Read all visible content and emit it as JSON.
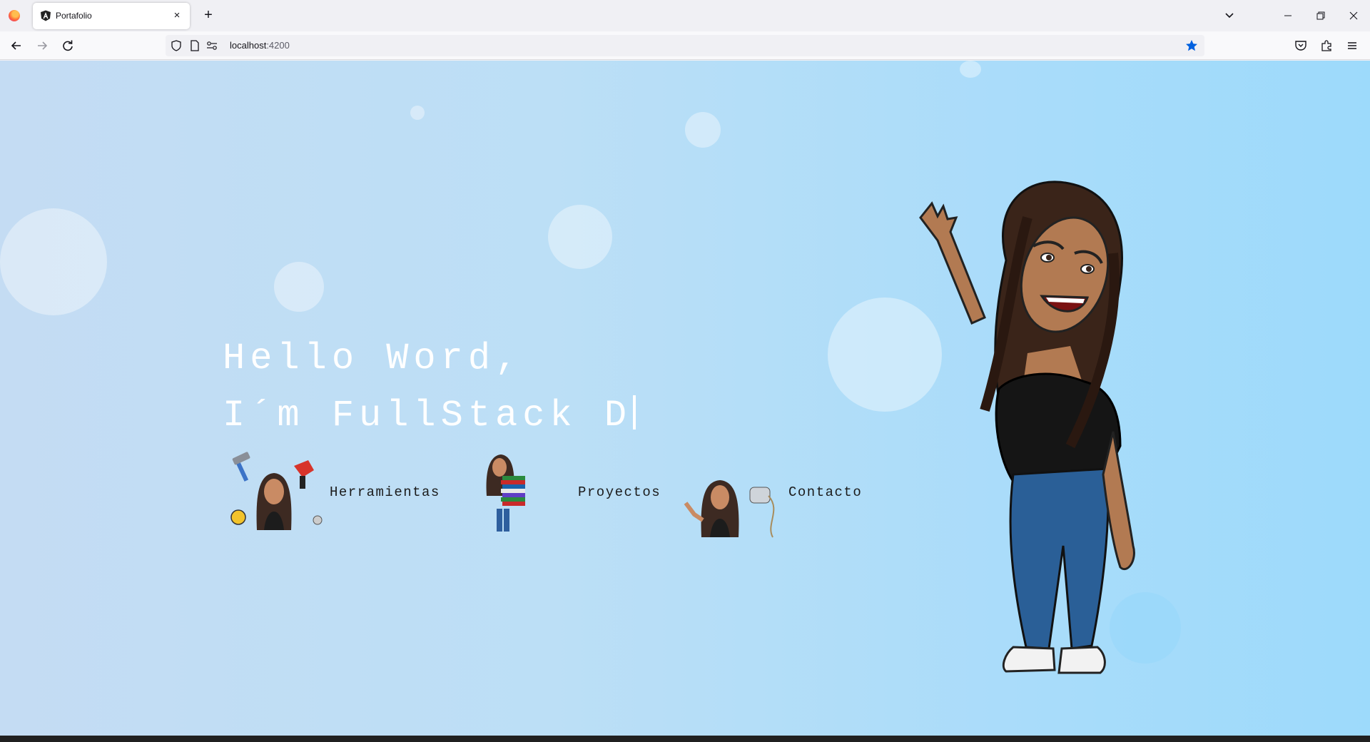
{
  "browser": {
    "tab_title": "Portafolio",
    "new_tab_label": "+",
    "tab_close_label": "×",
    "url_host": "localhost",
    "url_port": ":4200",
    "colors": {
      "star_blue": "#0060df",
      "firefox_orange": "#ff7139"
    }
  },
  "hero": {
    "line1": "Hello Word,",
    "line2": "I´m FullStack D"
  },
  "menu": [
    {
      "label": "Herramientas",
      "icon": "avatar-tools-icon"
    },
    {
      "label": "Proyectos",
      "icon": "avatar-books-icon"
    },
    {
      "label": "Contacto",
      "icon": "avatar-tin-can-phone-icon"
    }
  ],
  "illustration": {
    "icon": "waving-avatar"
  },
  "colors": {
    "background_start": "#c4dcf3",
    "background_end": "#9ddafb",
    "heading": "#ffffff"
  }
}
